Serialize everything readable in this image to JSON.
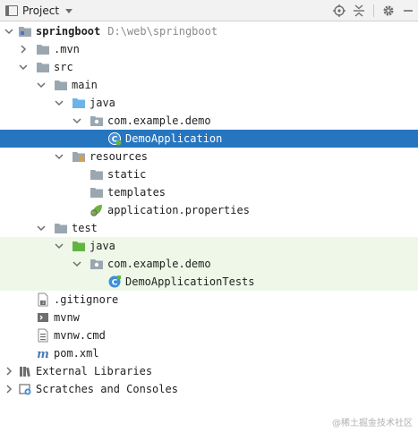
{
  "header": {
    "title": "Project"
  },
  "tree": {
    "root": {
      "label": "springboot",
      "path": "D:\\web\\springboot"
    },
    "mvn": ".mvn",
    "src": "src",
    "main": "main",
    "main_java": "java",
    "main_pkg": "com.example.demo",
    "demo_app": "DemoApplication",
    "resources": "resources",
    "static": "static",
    "templates": "templates",
    "app_props": "application.properties",
    "test": "test",
    "test_java": "java",
    "test_pkg": "com.example.demo",
    "demo_tests": "DemoApplicationTests",
    "gitignore": ".gitignore",
    "mvnw": "mvnw",
    "mvnw_cmd": "mvnw.cmd",
    "pom": "pom.xml",
    "ext_libs": "External Libraries",
    "scratches": "Scratches and Consoles"
  },
  "watermark": "@稀土掘金技术社区",
  "colors": {
    "selection": "#2675bf",
    "test_root_bg": "#eff7e8",
    "folder": "#9aa7b0",
    "source_folder": "#6db3e8",
    "test_folder": "#62b543"
  }
}
